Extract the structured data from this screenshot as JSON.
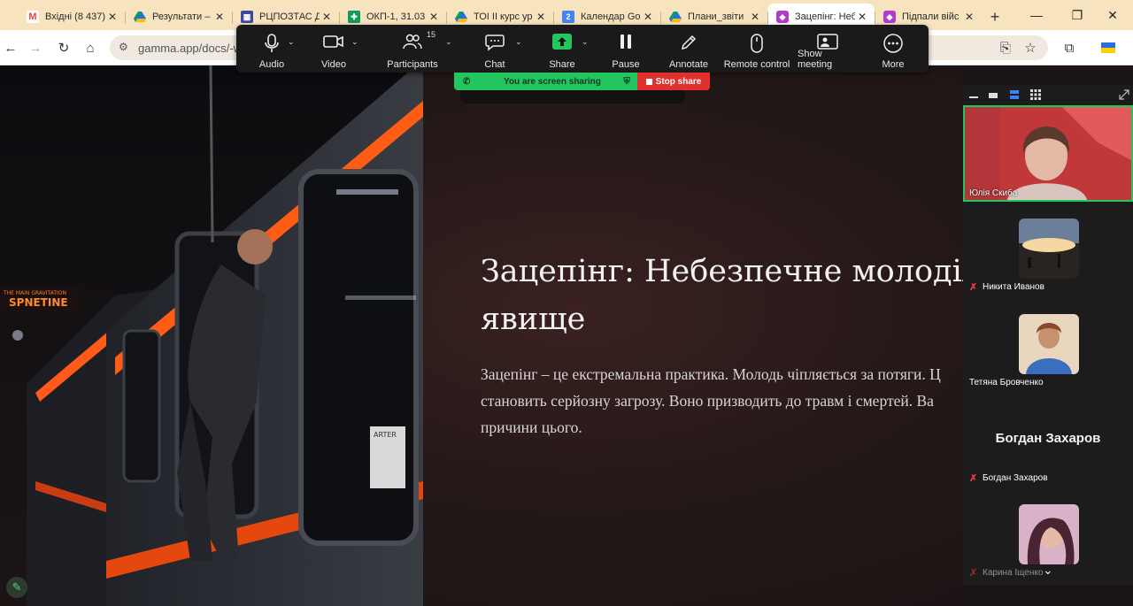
{
  "browser": {
    "tabs": [
      {
        "label": "Вхідні (8 437)",
        "icon": "gmail-icon",
        "color": "#ea4335",
        "active": false
      },
      {
        "label": "Результати –",
        "icon": "drive-icon",
        "color": "#1a73e8",
        "active": false
      },
      {
        "label": "РЦПОЗТАС Д",
        "icon": "sheets-slides-icon",
        "color": "#3c4a9c",
        "active": false
      },
      {
        "label": "ОКП-1, 31.03",
        "icon": "sheets-icon",
        "color": "#0f9d58",
        "active": false
      },
      {
        "label": "ТОІ ІІ курс ур",
        "icon": "drive-icon",
        "color": "#1a73e8",
        "active": false
      },
      {
        "label": "Календар Go",
        "icon": "calendar-icon",
        "color": "#4285f4",
        "active": false
      },
      {
        "label": "Плани_звіти",
        "icon": "drive-icon",
        "color": "#1a73e8",
        "active": false
      },
      {
        "label": "Зацепінг: Неб",
        "icon": "gamma-icon",
        "color": "#b03cc8",
        "active": true
      },
      {
        "label": "Підпали війс",
        "icon": "gamma-icon",
        "color": "#b03cc8",
        "active": false
      }
    ],
    "url": "gamma.app/docs/-w"
  },
  "zoom_toolbar": {
    "items": [
      {
        "label": "Audio",
        "icon": "microphone-icon"
      },
      {
        "label": "Video",
        "icon": "video-camera-icon"
      },
      {
        "label": "Participants",
        "icon": "participants-icon",
        "count": "15"
      },
      {
        "label": "Chat",
        "icon": "chat-icon"
      },
      {
        "label": "Share",
        "icon": "share-screen-icon"
      },
      {
        "label": "Pause",
        "icon": "pause-icon"
      },
      {
        "label": "Annotate",
        "icon": "pencil-icon"
      },
      {
        "label": "Remote control",
        "icon": "mouse-icon"
      },
      {
        "label": "Show meeting",
        "icon": "show-meeting-icon"
      },
      {
        "label": "More",
        "icon": "more-icon"
      }
    ],
    "sharing_status": "You are screen sharing",
    "stop_share_label": "Stop share",
    "accent": "#23c55e",
    "stop_color": "#e0312e"
  },
  "slide": {
    "title": "Зацепінг: Небезпечне молодіжн\nявище",
    "body": "Зацепінг – це екстремальна практика. Молодь чіпляється за потяги. Ц\nстановить серйозну загрозу. Воно призводить до травм і смертей. Ва\nпричини цього.",
    "image_sign_1": "THE MAIN GRAVITATION",
    "image_sign_2": "SPNETINE",
    "image_sign_3": "ARTER"
  },
  "participants": [
    {
      "name": "Юлія Скиба",
      "muted": false,
      "active_speaker": true
    },
    {
      "name": "Никита Иванов",
      "muted": true,
      "active_speaker": false
    },
    {
      "name": "Тетяна Бровченко",
      "muted": false,
      "active_speaker": false
    },
    {
      "name": "Богдан Захаров",
      "muted": true,
      "active_speaker": false,
      "no_video": true
    },
    {
      "name": "Карина Іщенко",
      "muted": true,
      "active_speaker": false
    }
  ]
}
